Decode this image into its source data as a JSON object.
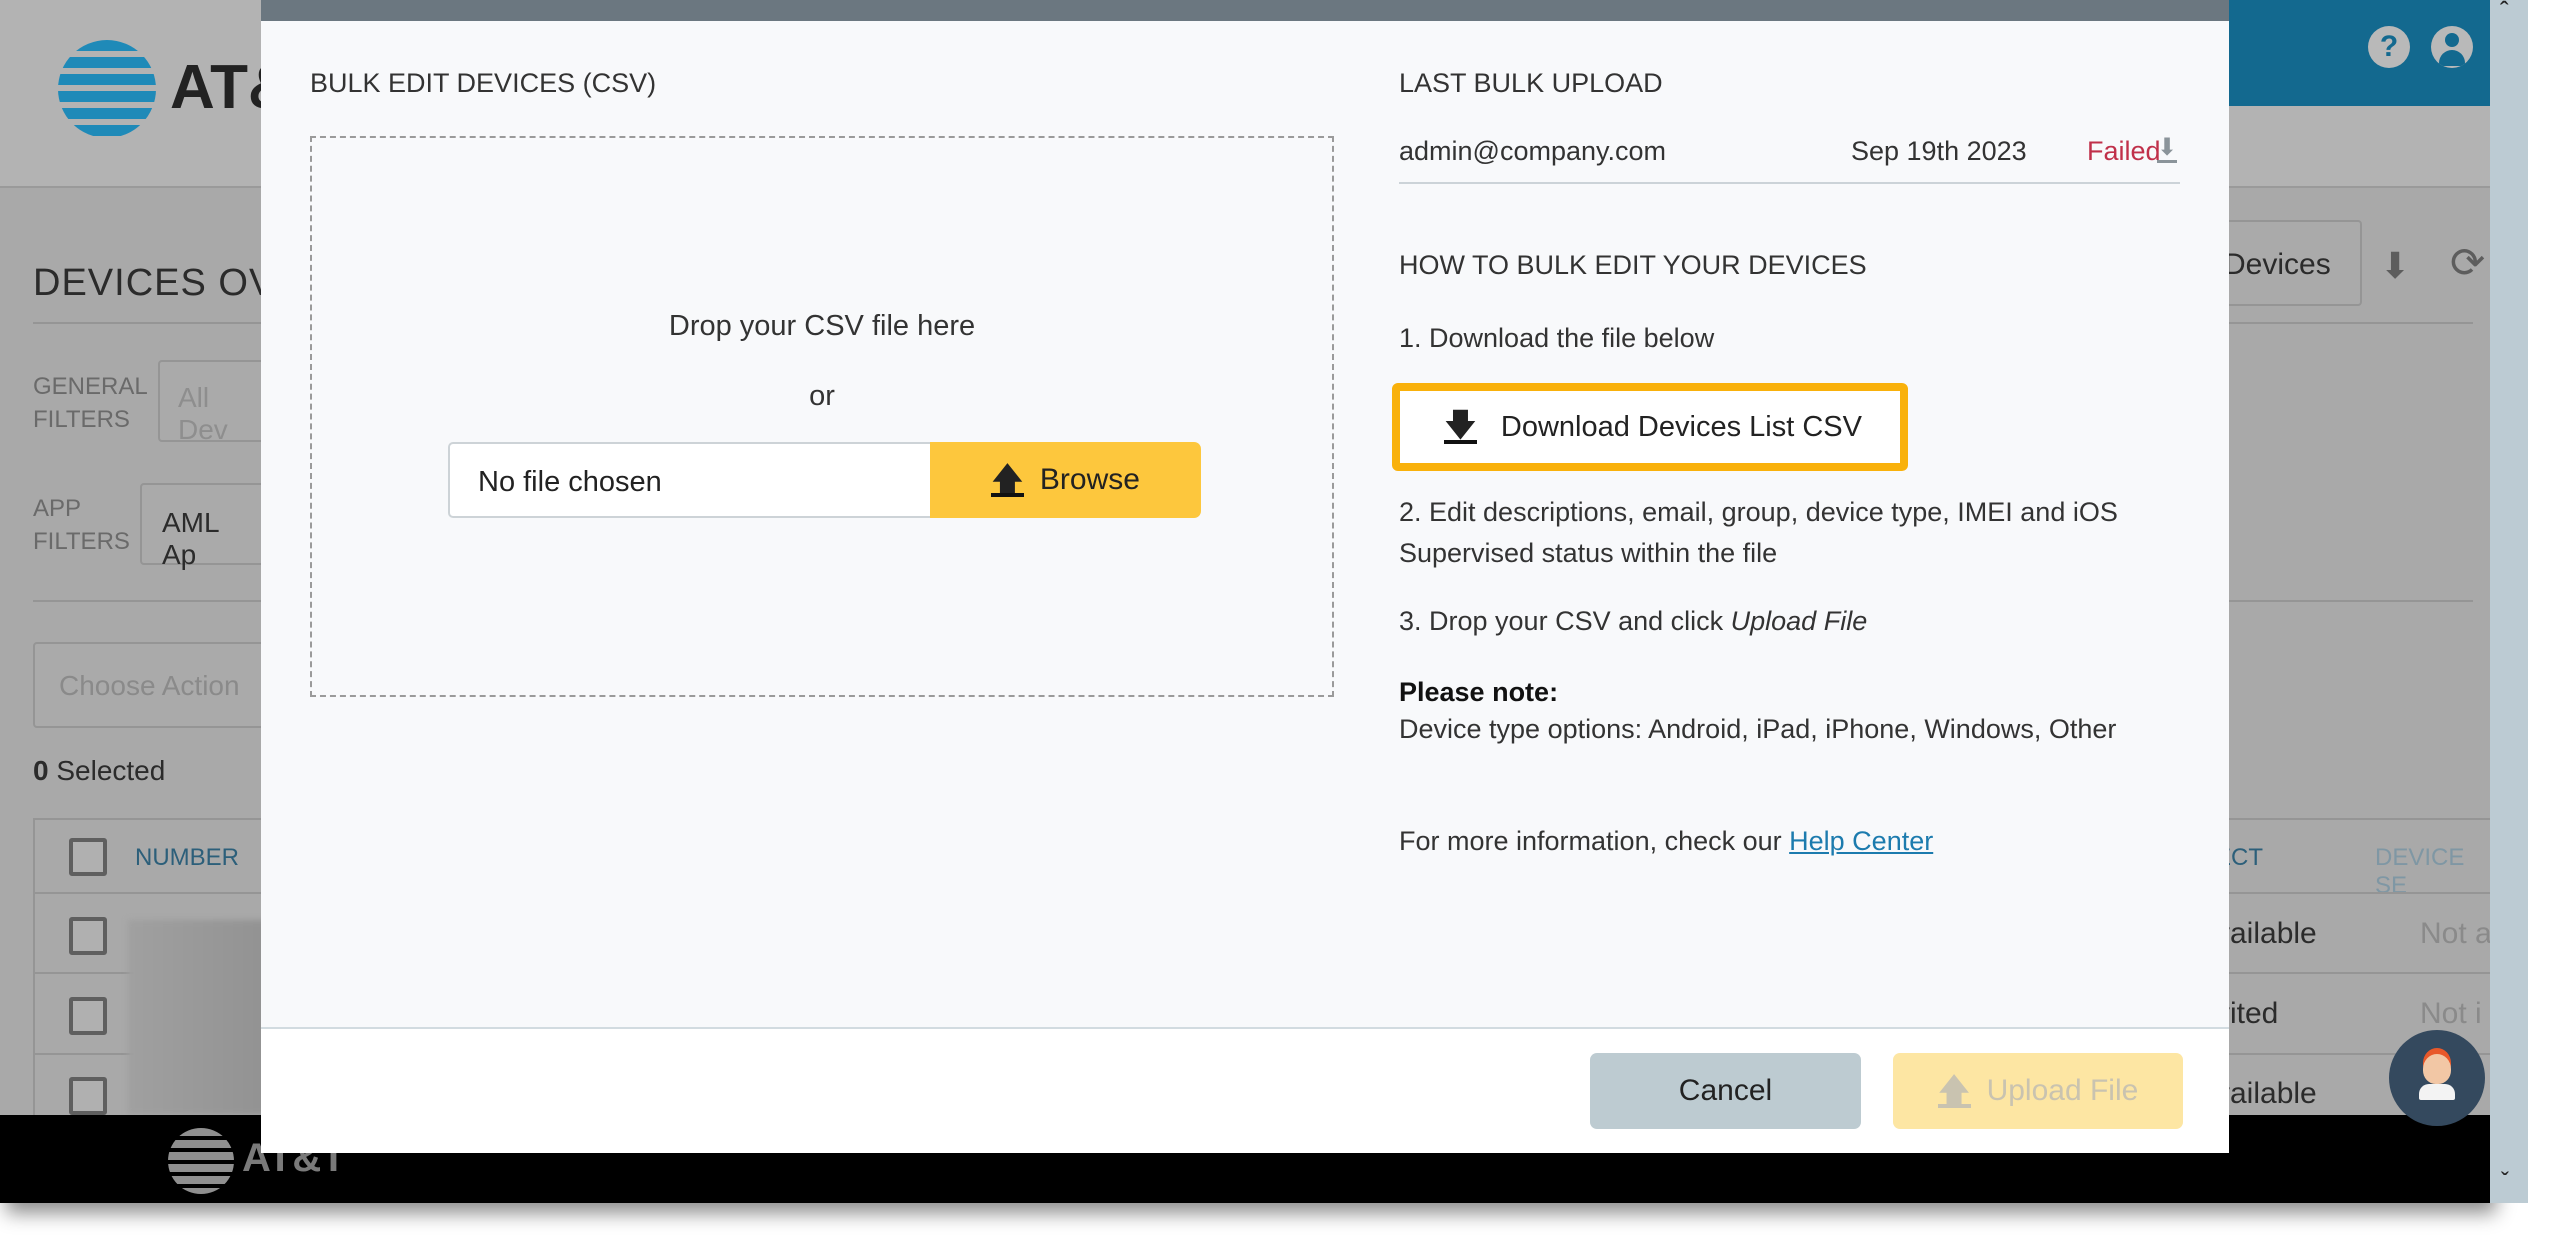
{
  "background": {
    "brand_text": "AT&",
    "page_title": "DEVICES OVER",
    "general_filters_label": "GENERAL FILTERS",
    "general_filters_value": "All Dev",
    "app_filters_label": "APP FILTERS",
    "app_filters_value": "AML Ap",
    "choose_action_placeholder": "Choose Action",
    "selected_count": "0",
    "selected_label": "Selected",
    "devices_button": "Devices",
    "columns": [
      "NUMBER",
      "ECT",
      "DEVICE SE"
    ],
    "rows": [
      {
        "status": "vailable",
        "security": "Not a"
      },
      {
        "status": "vited",
        "security": "Not i"
      },
      {
        "status": "vailable",
        "security": ""
      }
    ],
    "footer_brand": "AT&T",
    "header_color": "#13698f"
  },
  "modal": {
    "title": "BULK EDIT DEVICES (CSV)",
    "dropzone_text": "Drop your CSV file here",
    "or_text": "or",
    "file_input_value": "No file chosen",
    "browse_label": "Browse",
    "last_upload": {
      "heading": "LAST BULK UPLOAD",
      "user": "admin@company.com",
      "date": "Sep 19th 2023",
      "status": "Failed",
      "status_color": "#c0304a"
    },
    "howto": {
      "heading": "HOW TO BULK EDIT YOUR DEVICES",
      "step1": "1. Download the file below",
      "download_button": "Download Devices List CSV",
      "step2_line1": "2. Edit descriptions, email, group, device type, IMEI and iOS",
      "step2_line2": "Supervised status within the file",
      "step3_prefix": "3. Drop your CSV and click ",
      "step3_em": "Upload File",
      "note_heading": "Please note:",
      "note_text": "Device type options: Android, iPad, iPhone, Windows, Other",
      "more_info": "For more information, check our ",
      "help_link": "Help Center"
    },
    "cancel_label": "Cancel",
    "upload_label": "Upload File",
    "accent_color": "#fdc73d",
    "highlight_color": "#f9b10b"
  }
}
